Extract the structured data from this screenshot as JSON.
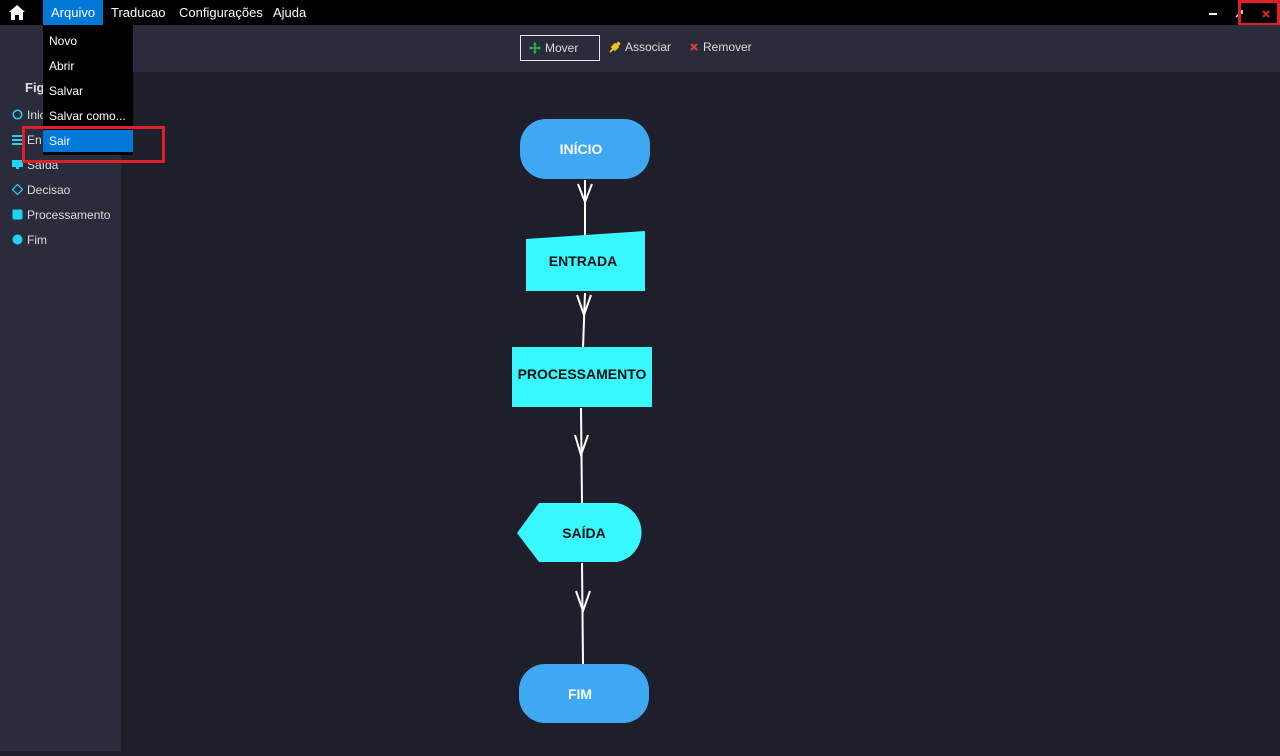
{
  "menubar": {
    "items": [
      "Arquivo",
      "Traducao",
      "Configurações",
      "Ajuda"
    ],
    "active": "Arquivo"
  },
  "dropdown": {
    "items": [
      "Novo",
      "Abrir",
      "Salvar",
      "Salvar como...",
      "Sair"
    ],
    "selected": "Sair"
  },
  "sidebar": {
    "title": "Fig",
    "items": [
      {
        "label": "Inic",
        "icon": "circle-outline-icon"
      },
      {
        "label": "En",
        "icon": "lines-icon"
      },
      {
        "label": "Saída",
        "icon": "monitor-icon"
      },
      {
        "label": "Decisao",
        "icon": "diamond-icon"
      },
      {
        "label": "Processamento",
        "icon": "square-icon"
      },
      {
        "label": "Fim",
        "icon": "circle-filled-icon"
      }
    ]
  },
  "toolbar": {
    "move_label": "Mover",
    "associate_label": "Associar",
    "remove_label": "Remover"
  },
  "flowchart": {
    "nodes": [
      "INÍCIO",
      "ENTRADA",
      "PROCESSAMENTO",
      "SAÍDA",
      "FIM"
    ]
  },
  "colors": {
    "accent": "#0078d7",
    "terminal": "#3ea8f2",
    "node": "#39f7ff",
    "highlight": "#e11f2a"
  }
}
